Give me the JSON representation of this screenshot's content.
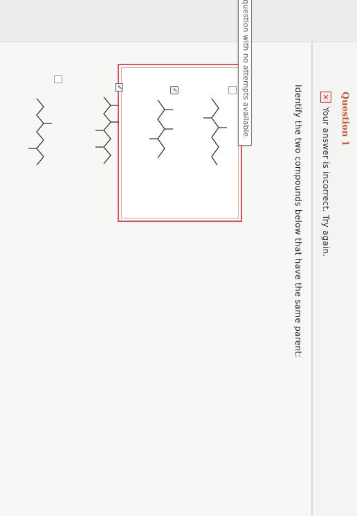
{
  "question": {
    "title": "Question 1"
  },
  "feedback": {
    "icon": "x-icon",
    "text": "Your answer is incorrect.  Try again."
  },
  "prompt": "Identify the two compounds below that have the same parent:",
  "tooltip": "question with no attempts available.",
  "choices": [
    {
      "checked": false
    },
    {
      "checked": true
    },
    {
      "checked": true
    },
    {
      "checked": false
    }
  ],
  "colors": {
    "error_red": "#e05050",
    "title_orange": "#c9562f"
  }
}
